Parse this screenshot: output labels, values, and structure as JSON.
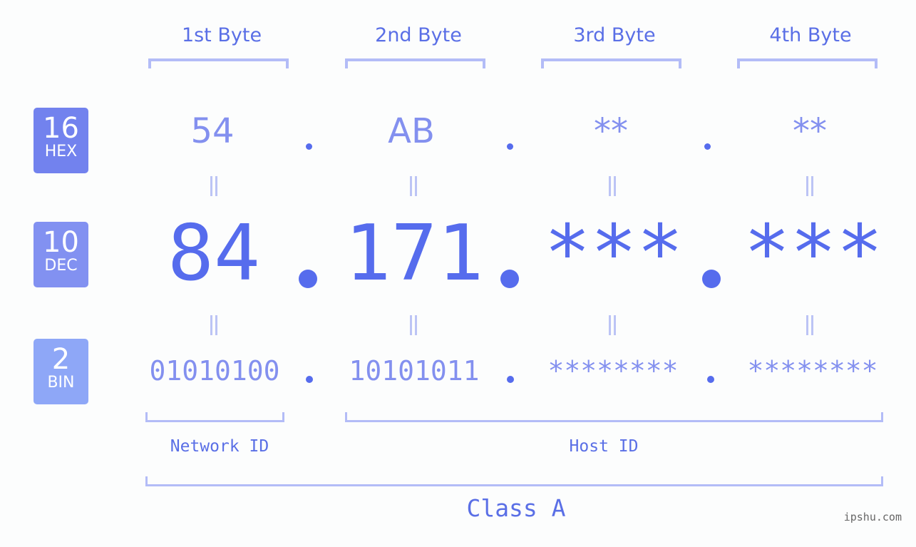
{
  "byte_headers": [
    "1st Byte",
    "2nd Byte",
    "3rd Byte",
    "4th Byte"
  ],
  "rows": {
    "hex": {
      "base": "16",
      "label": "HEX",
      "values": [
        "54",
        "AB",
        "**",
        "**"
      ],
      "color": "#7282ee"
    },
    "dec": {
      "base": "10",
      "label": "DEC",
      "values": [
        "84",
        "171",
        "***",
        "***"
      ],
      "color": "#8291f1"
    },
    "bin": {
      "base": "2",
      "label": "BIN",
      "values": [
        "01010100",
        "10101011",
        "********",
        "********"
      ],
      "color": "#8ea7f7"
    }
  },
  "separator": ".",
  "ranges": {
    "network_id": "Network ID",
    "host_id": "Host ID",
    "class": "Class A"
  },
  "watermark": "ipshu.com",
  "colors": {
    "accent": "#566ced",
    "text": "#5a6fe6",
    "muted_value": "#8390ef",
    "bracket": "#b3bcf7"
  }
}
